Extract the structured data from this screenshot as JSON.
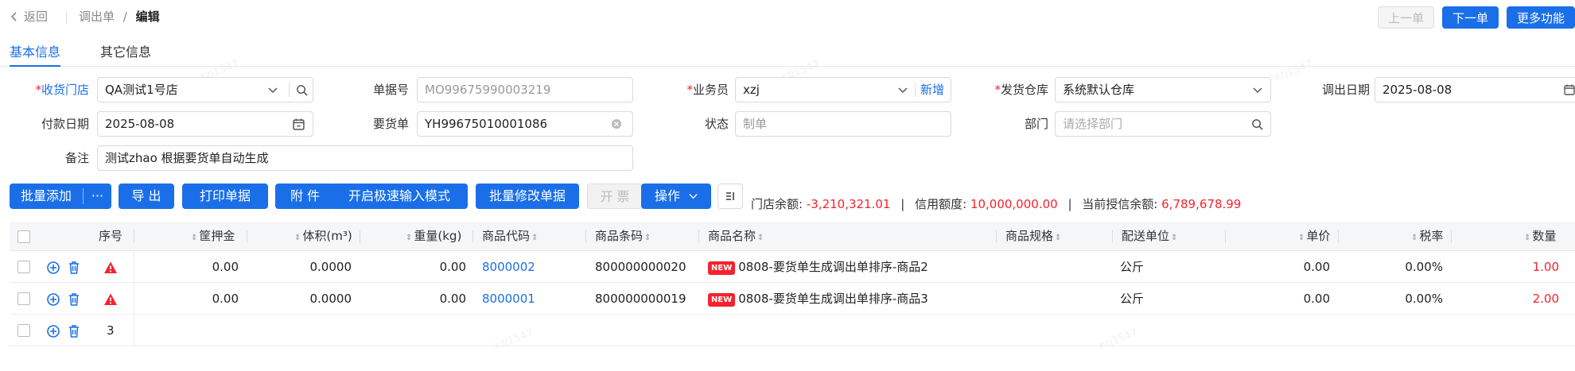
{
  "header": {
    "back_label": "返回",
    "breadcrumb_parent": "调出单",
    "breadcrumb_sep": "/",
    "breadcrumb_current": "编辑",
    "prev_label": "上一单",
    "next_label": "下一单",
    "more_label": "更多功能"
  },
  "tabs": [
    {
      "label": "基本信息",
      "active": true
    },
    {
      "label": "其它信息",
      "active": false
    }
  ],
  "form": {
    "receive_store": {
      "label": "收货门店",
      "value": "QA测试1号店"
    },
    "doc_no": {
      "label": "单据号",
      "value": "MO99675990003219"
    },
    "salesman": {
      "label": "业务员",
      "value": "xzj",
      "add_label": "新增"
    },
    "ship_warehouse": {
      "label": "发货仓库",
      "value": "系统默认仓库"
    },
    "out_date": {
      "label": "调出日期",
      "value": "2025-08-08"
    },
    "pay_date": {
      "label": "付款日期",
      "value": "2025-08-08"
    },
    "request_doc": {
      "label": "要货单",
      "value": "YH99675010001086"
    },
    "status": {
      "label": "状态",
      "value": "制单"
    },
    "department": {
      "label": "部门",
      "placeholder": "请选择部门"
    },
    "remark": {
      "label": "备注",
      "value": "测试zhao  根据要货单自动生成"
    }
  },
  "toolbar": {
    "batch_add": "批量添加",
    "batch_more": "···",
    "export": "导 出",
    "print": "打印单据",
    "attach": "附 件",
    "fast_input": "开启极速输入模式",
    "batch_edit": "批量修改单据",
    "invoice": "开 票",
    "operate": "操作"
  },
  "balance": {
    "store_label": "门店余额:",
    "store_value": "-3,210,321.01",
    "sep": "|",
    "credit_label": "信用额度:",
    "credit_value": "10,000,000.00",
    "available_label": "当前授信余额:",
    "available_value": "6,789,678.99"
  },
  "table": {
    "columns": {
      "seq": "序号",
      "deposit": "筐押金",
      "volume": "体积(m³)",
      "weight": "重量(kg)",
      "code": "商品代码",
      "barcode": "商品条码",
      "name": "商品名称",
      "spec": "商品规格",
      "unit": "配送单位",
      "price": "单价",
      "tax": "税率",
      "qty": "数量"
    },
    "new_tag": "NEW",
    "rows": [
      {
        "deposit": "0.00",
        "volume": "0.0000",
        "weight": "0.00",
        "code": "8000002",
        "barcode": "800000000020",
        "name": "0808-要货单生成调出单排序-商品2",
        "unit": "公斤",
        "price": "0.00",
        "tax": "0.00%",
        "qty": "1.00"
      },
      {
        "deposit": "0.00",
        "volume": "0.0000",
        "weight": "0.00",
        "code": "8000001",
        "barcode": "800000000019",
        "name": "0808-要货单生成调出单排序-商品3",
        "unit": "公斤",
        "price": "0.00",
        "tax": "0.00%",
        "qty": "2.00"
      }
    ],
    "next_seq": "3"
  },
  "colors": {
    "primary": "#1a6fe8",
    "danger": "#f5222d"
  }
}
